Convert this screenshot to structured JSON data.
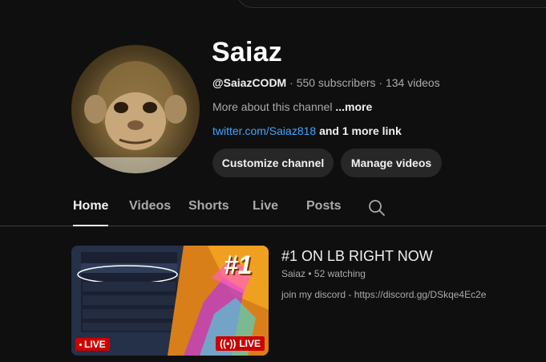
{
  "channel": {
    "name": "Saiaz",
    "handle": "@SaiazCODM",
    "subscribers": "550 subscribers",
    "videos": "134 videos",
    "about": "More about this channel",
    "about_more": "...more",
    "link": "twitter.com/Saiaz818",
    "more_links": "and 1 more link"
  },
  "actions": {
    "customize_label": "Customize channel",
    "manage_label": "Manage videos"
  },
  "tabs": [
    {
      "label": "Home",
      "active": true
    },
    {
      "label": "Videos",
      "active": false
    },
    {
      "label": "Shorts",
      "active": false
    },
    {
      "label": "Live",
      "active": false
    },
    {
      "label": "Posts",
      "active": false
    }
  ],
  "featured_video": {
    "title": "#1 ON LB RIGHT NOW",
    "channel": "Saiaz",
    "watching": "52 watching",
    "description": "join my discord - https://discord.gg/DSkqe4Ec2e",
    "live_badge": "LIVE",
    "live_badge_right": "LIVE",
    "thumb_text": "#1"
  },
  "icons": {
    "tab_search": "search-icon",
    "live_dot": "broadcast-icon"
  },
  "colors": {
    "background": "#0f0f0f",
    "link": "#3ea6ff",
    "live": "#cc0000",
    "button_bg": "#272727"
  }
}
